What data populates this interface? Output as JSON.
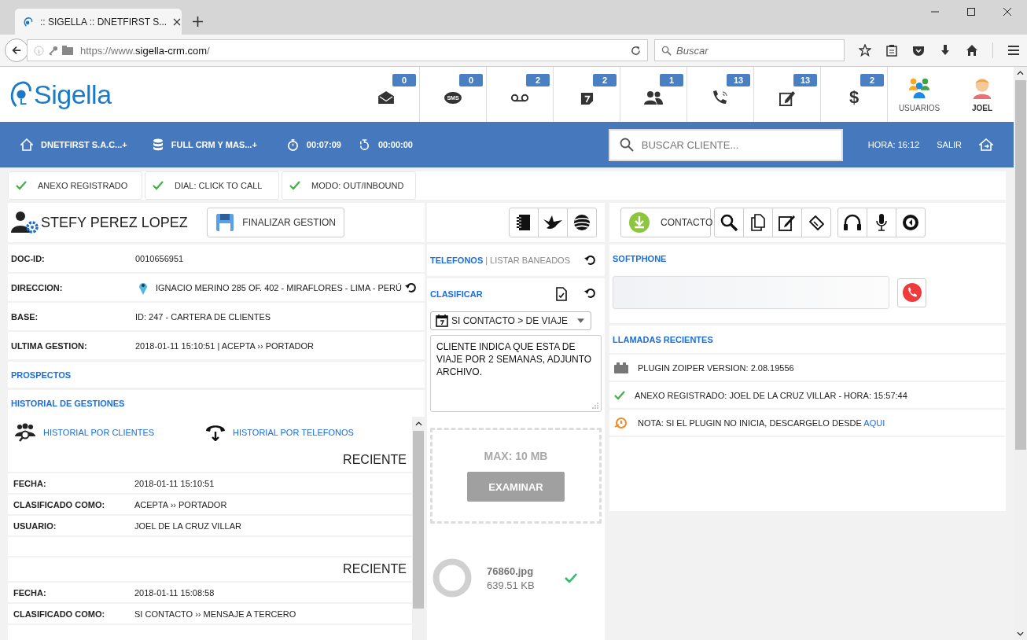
{
  "browser": {
    "tab_title": ":: SIGELLA :: DNETFIRST S...",
    "url_prefix": "https://www.",
    "url_domain": "sigella-crm.com",
    "url_path": "/",
    "search_placeholder": "Buscar"
  },
  "header": {
    "logo": "Sigella",
    "counters": [
      {
        "kind": "mail",
        "count": "0"
      },
      {
        "kind": "sms",
        "label": "SMS",
        "count": "0"
      },
      {
        "kind": "voicemail",
        "count": "2"
      },
      {
        "kind": "calendar",
        "count": "2"
      },
      {
        "kind": "contacts",
        "count": "1"
      },
      {
        "kind": "phone",
        "count": "13"
      },
      {
        "kind": "edit",
        "count": "13"
      },
      {
        "kind": "money",
        "label": "$",
        "count": "2"
      }
    ],
    "users_label": "USUARIOS",
    "user_name": "JOEL"
  },
  "nav": {
    "company": "DNETFIRST S.A.C...+",
    "campaign": "FULL CRM Y MAS...+",
    "timer_1": "00:07:09",
    "timer_2": "00:00:00",
    "search_placeholder": "BUSCAR CLIENTE...",
    "time": "HORA: 16:12",
    "logout": "SALIR"
  },
  "status_chips": [
    {
      "label": "ANEXO REGISTRADO",
      "ok": true
    },
    {
      "label": "DIAL: CLICK TO CALL",
      "ok": true
    },
    {
      "label": "MODO: OUT/INBOUND",
      "ok": true
    }
  ],
  "client": {
    "name": "STEFY PEREZ LOPEZ",
    "finish_button": "FINALIZAR GESTION",
    "fields": [
      {
        "label": "DOC-ID:",
        "value": "0010656951",
        "kind": "text"
      },
      {
        "label": "DIRECCION:",
        "value": "IGNACIO MERINO 285 OF. 402 - MIRAFLORES - LIMA - PERÚ",
        "kind": "address"
      },
      {
        "label": "BASE:",
        "value": "ID: 247 - CARTERA DE CLIENTES",
        "kind": "text"
      },
      {
        "label": "ULTIMA GESTION:",
        "value": "2018-01-11 15:10:51 | ACEPTA ›› PORTADOR",
        "kind": "text"
      }
    ]
  },
  "prospects_title": "PROSPECTOS",
  "history": {
    "title": "HISTORIAL DE GESTIONES",
    "link_clients": "HISTORIAL POR CLIENTES",
    "link_phones": "HISTORIAL POR TELEFONOS",
    "entries": [
      {
        "heading": "RECIENTE",
        "rows": [
          {
            "label": "FECHA:",
            "value": "2018-01-11 15:10:51"
          },
          {
            "label": "CLASIFICADO COMO:",
            "value": "ACEPTA ›› PORTADOR"
          },
          {
            "label": "USUARIO:",
            "value": "JOEL DE LA CRUZ VILLAR"
          }
        ]
      },
      {
        "heading": "RECIENTE",
        "rows": [
          {
            "label": "FECHA:",
            "value": "2018-01-11 15:08:58"
          },
          {
            "label": "CLASIFICADO COMO:",
            "value": "SI CONTACTO ›› MENSAJE A TERCERO"
          }
        ]
      }
    ]
  },
  "phones": {
    "title": "TELEFONOS",
    "separator": "|",
    "link": "LISTAR BANEADOS"
  },
  "classify": {
    "title": "CLASIFICAR",
    "selection": "SI CONTACTO > DE VIAJE",
    "note": "CLIENTE INDICA QUE ESTA DE VIAJE POR 2 SEMANAS, ADJUNTO ARCHIVO."
  },
  "upload": {
    "limit": "MAX: 10 MB",
    "button": "EXAMINAR",
    "file": {
      "name": "76860.jpg",
      "size": "639.51 KB",
      "done": true
    }
  },
  "contact_button": "CONTACTO",
  "softphone": {
    "title": "SOFTPHONE"
  },
  "recent_calls": {
    "title": "LLAMADAS RECIENTES",
    "log": [
      {
        "kind": "plugin",
        "text": "PLUGIN ZOIPER VERSION: 2.08.19556"
      },
      {
        "kind": "ok",
        "text": "ANEXO REGISTRADO: JOEL DE LA CRUZ VILLAR - HORA: 15:57:44"
      },
      {
        "kind": "note",
        "text": "NOTA: SI EL PLUGIN NO INICIA, DESCARGELO DESDE",
        "link": "AQUI"
      }
    ]
  }
}
